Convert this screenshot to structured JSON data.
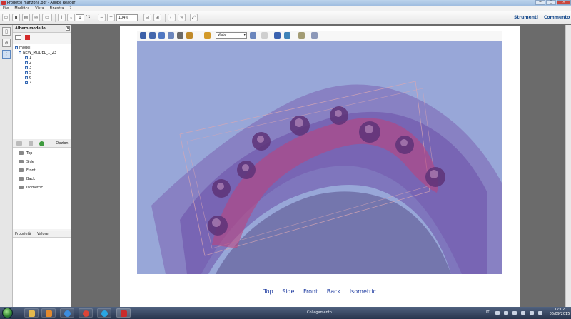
{
  "window": {
    "title": "Progetto manzoni .pdf - Adobe Reader",
    "controls": [
      "−",
      "□",
      "×"
    ]
  },
  "menu": {
    "items": [
      "File",
      "Modifica",
      "Vista",
      "Finestra",
      "?"
    ]
  },
  "toolbar": {
    "page_current": "1",
    "page_total": "/ 1",
    "zoom": "104%",
    "strumenti_label": "Strumenti",
    "commento_label": "Commento"
  },
  "model_tree": {
    "title": "Albero modello",
    "close_icon": "×",
    "root": "model",
    "node": "NEW_MODEL_1_23",
    "children": [
      "1",
      "2",
      "3",
      "5",
      "6",
      "7"
    ]
  },
  "views_panel": {
    "options_label": "Opzioni",
    "views": [
      "Top",
      "Side",
      "Front",
      "Back",
      "Isometric"
    ]
  },
  "properties": {
    "col_property": "Proprietà",
    "col_value": "Valore"
  },
  "viewer3d": {
    "views_dropdown": "Viste",
    "background_color": "#98a7d8",
    "model_color": "#6b4fa8",
    "implant_color": "#b9457f"
  },
  "view_links": [
    "Top",
    "Side",
    "Front",
    "Back",
    "Isometric"
  ],
  "taskbar": {
    "status": "Collegamento",
    "lang": "IT",
    "time": "17:02",
    "date": "06/09/2015"
  }
}
